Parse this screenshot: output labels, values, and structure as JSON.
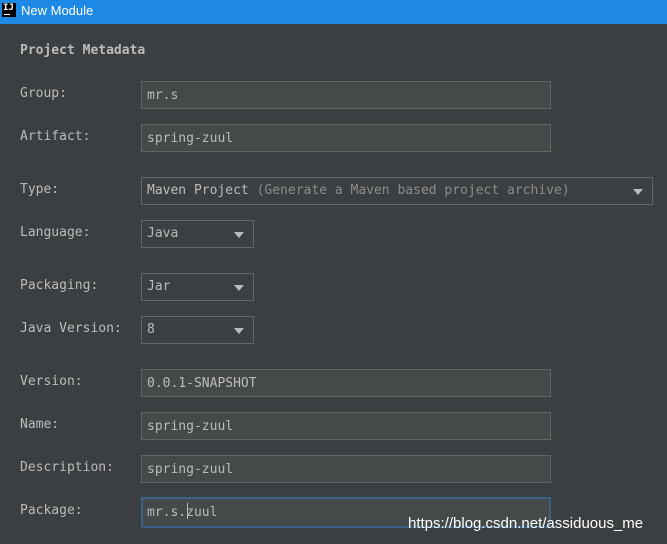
{
  "window": {
    "title": "New Module"
  },
  "section": {
    "title": "Project Metadata"
  },
  "form": {
    "group": {
      "label": "Group:",
      "value": "mr.s"
    },
    "artifact": {
      "label": "Artifact:",
      "value": "spring-zuul"
    },
    "type": {
      "label": "Type:",
      "value": "Maven Project",
      "hint": "(Generate a Maven based project archive)"
    },
    "language": {
      "label": "Language:",
      "value": "Java"
    },
    "packaging": {
      "label": "Packaging:",
      "value": "Jar"
    },
    "java_version": {
      "label": "Java Version:",
      "value": "8"
    },
    "version": {
      "label": "Version:",
      "value": "0.0.1-SNAPSHOT"
    },
    "name": {
      "label": "Name:",
      "value": "spring-zuul"
    },
    "description": {
      "label": "Description:",
      "value": "spring-zuul"
    },
    "package": {
      "label": "Package:",
      "value": "mr.s.zuul"
    }
  },
  "watermark": "https://blog.csdn.net/assiduous_me"
}
